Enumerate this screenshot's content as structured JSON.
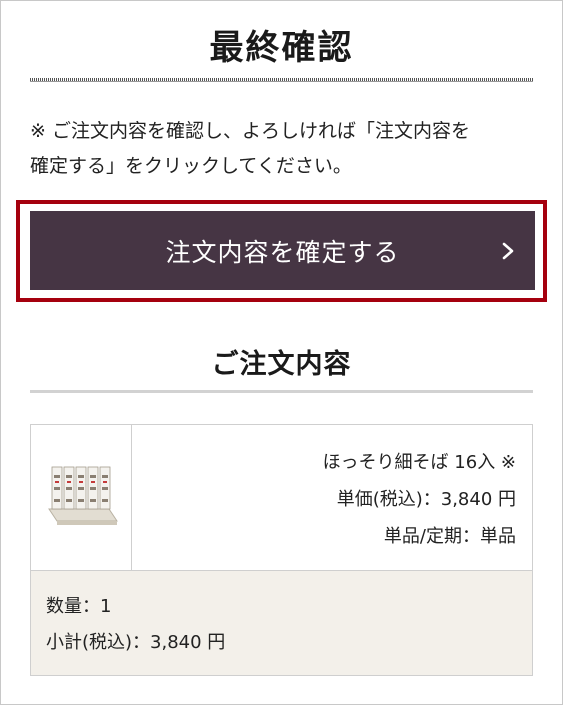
{
  "header": {
    "title": "最終確認"
  },
  "notice": {
    "line1": "※ ご注文内容を確認し、よろしければ「注文内容を",
    "line2": "確定する」をクリックしてください。"
  },
  "confirm": {
    "label": "注文内容を確定する",
    "icon": "chevron-right-icon",
    "bg_color": "#463544",
    "highlight_color": "#a5000e"
  },
  "order": {
    "section_title": "ご注文内容",
    "item": {
      "name": "ほっそり細そば 16入 ※",
      "unit_price": "単価(税込)：3,840 円",
      "type": "単品/定期：単品",
      "image_icon": "product-box-image"
    },
    "quantity": "数量：1",
    "subtotal": "小計(税込)：3,840 円",
    "summary_bg": "#f3f0ea"
  }
}
